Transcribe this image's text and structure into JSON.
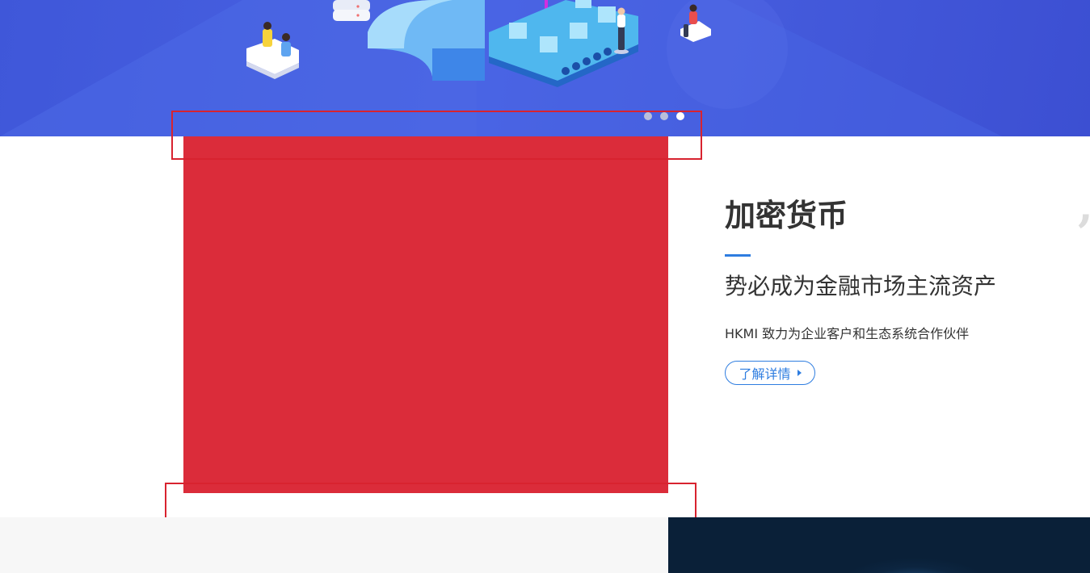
{
  "hero": {
    "carousel": {
      "slide_count": 3,
      "active_index": 2
    },
    "colors": {
      "background": "#4a63e3",
      "dot_active": "#ffffff",
      "dot_inactive": "#b9bfdc"
    }
  },
  "feature": {
    "title": "加密货币",
    "subtitle": "势必成为金融市场主流资产",
    "description": "HKMI 致力为企业客户和生态系统合作伙伴",
    "button_label": "了解详情",
    "quote_mark": ",",
    "colors": {
      "accent": "#2e7de0",
      "image_placeholder": "#db2c3a",
      "text": "#333333"
    }
  }
}
